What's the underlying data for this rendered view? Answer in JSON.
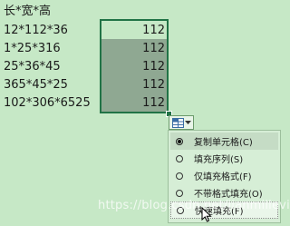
{
  "sheet": {
    "header": "长*宽*高",
    "rows": [
      {
        "formula": "12*112*36",
        "value": "112"
      },
      {
        "formula": "1*25*316",
        "value": "112"
      },
      {
        "formula": "25*36*45",
        "value": "112"
      },
      {
        "formula": "365*45*25",
        "value": "112"
      },
      {
        "formula": "102*306*6525",
        "value": "112"
      }
    ]
  },
  "autofill_menu": {
    "items": [
      {
        "label": "复制单元格(C)",
        "selected": true
      },
      {
        "label": "填充序列(S)",
        "selected": false
      },
      {
        "label": "仅填充格式(F)",
        "selected": false
      },
      {
        "label": "不带格式填充(O)",
        "selected": false
      },
      {
        "label": "快速填充(F)",
        "selected": false
      }
    ]
  },
  "watermark": "https://blog.csdn.net/jianmillevin",
  "colors": {
    "selection_border": "#217346",
    "fill": "#8fa892",
    "background": "#c6e8c6"
  }
}
